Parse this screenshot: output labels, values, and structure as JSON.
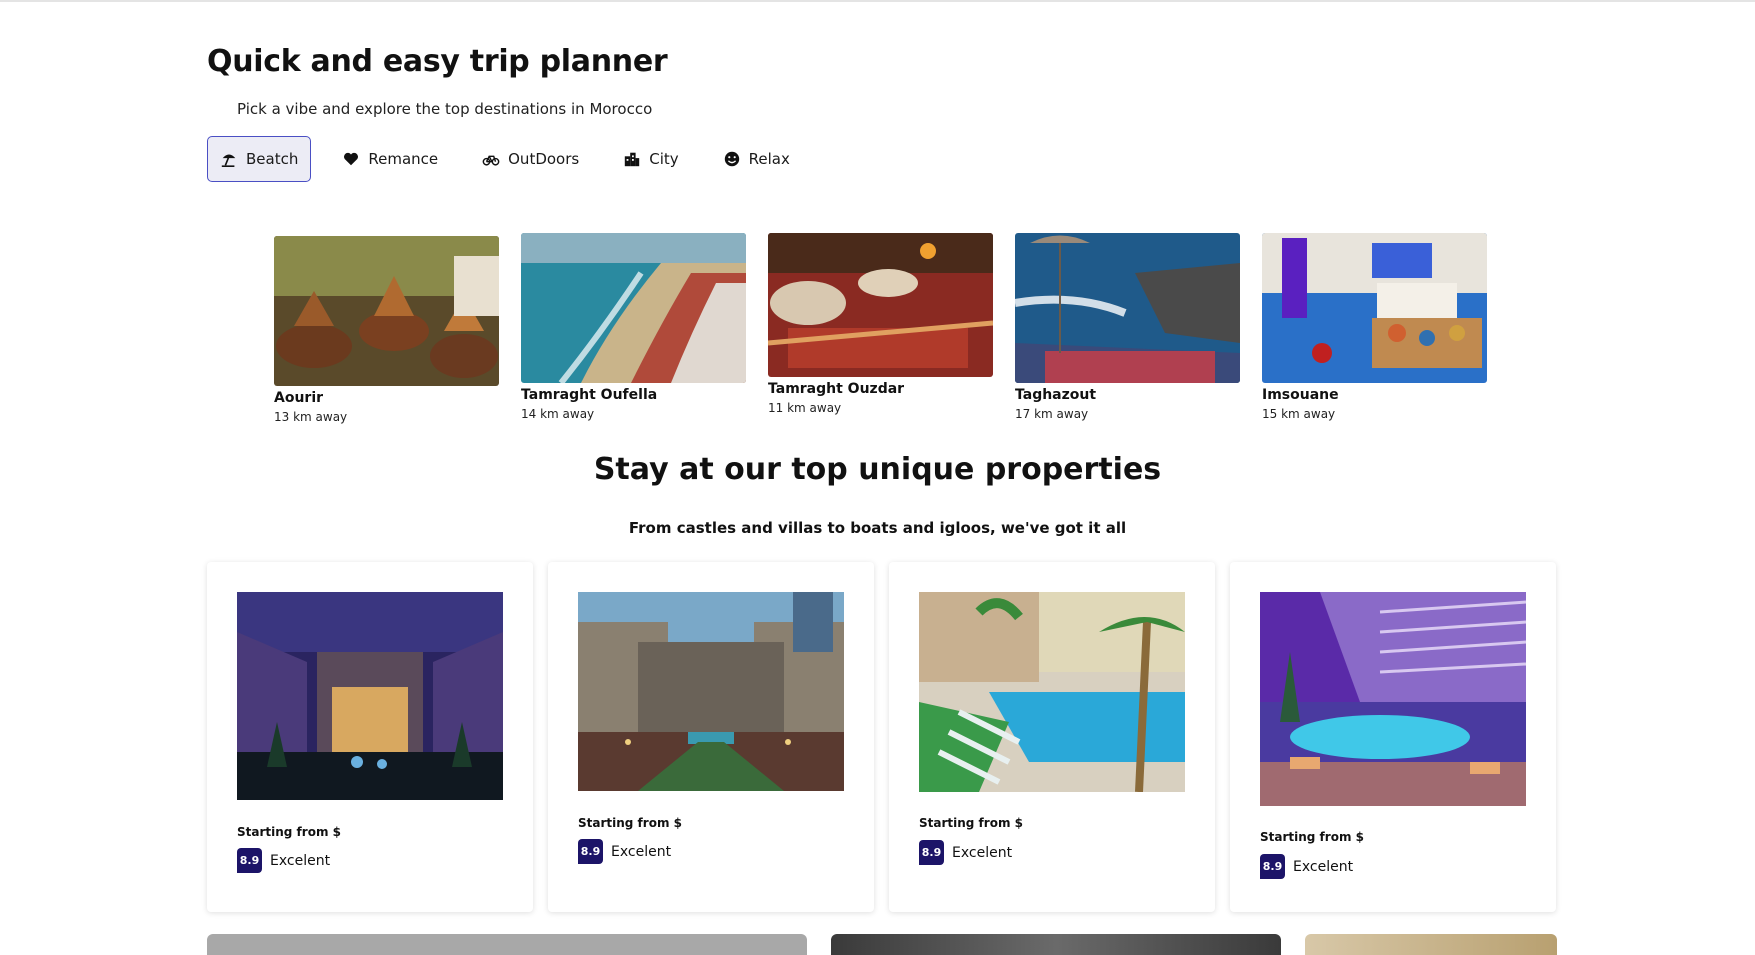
{
  "planner": {
    "title": "Quick and easy trip planner",
    "subtitle": "Pick a vibe and explore the top destinations in Morocco"
  },
  "vibes": [
    {
      "label": "Beatch",
      "icon": "beach-umbrella-icon",
      "active": true
    },
    {
      "label": "Remance",
      "icon": "heart-icon",
      "active": false
    },
    {
      "label": "OutDoors",
      "icon": "bicycle-icon",
      "active": false
    },
    {
      "label": "City",
      "icon": "city-buildings-icon",
      "active": false
    },
    {
      "label": "Relax",
      "icon": "smiley-face-icon",
      "active": false
    }
  ],
  "destinations": [
    {
      "name": "Aourir",
      "distance": "13 km away"
    },
    {
      "name": "Tamraght Oufella",
      "distance": "14 km away"
    },
    {
      "name": "Tamraght Ouzdar",
      "distance": "11 km away"
    },
    {
      "name": "Taghazout",
      "distance": "17 km away"
    },
    {
      "name": "Imsouane",
      "distance": "15 km away"
    }
  ],
  "properties": {
    "title": "Stay at our top unique properties",
    "subtitle": "From castles and villas to boats and igloos, we've got it all",
    "items": [
      {
        "from": "Starting from $",
        "score": "8.9",
        "rating": "Excelent"
      },
      {
        "from": "Starting from $",
        "score": "8.9",
        "rating": "Excelent"
      },
      {
        "from": "Starting from $",
        "score": "8.9",
        "rating": "Excelent"
      },
      {
        "from": "Starting from $",
        "score": "8.9",
        "rating": "Excelent"
      }
    ]
  },
  "colors": {
    "accent": "#4a4fc4",
    "score_badge": "#1c1468",
    "active_chip": "#ececf5"
  }
}
